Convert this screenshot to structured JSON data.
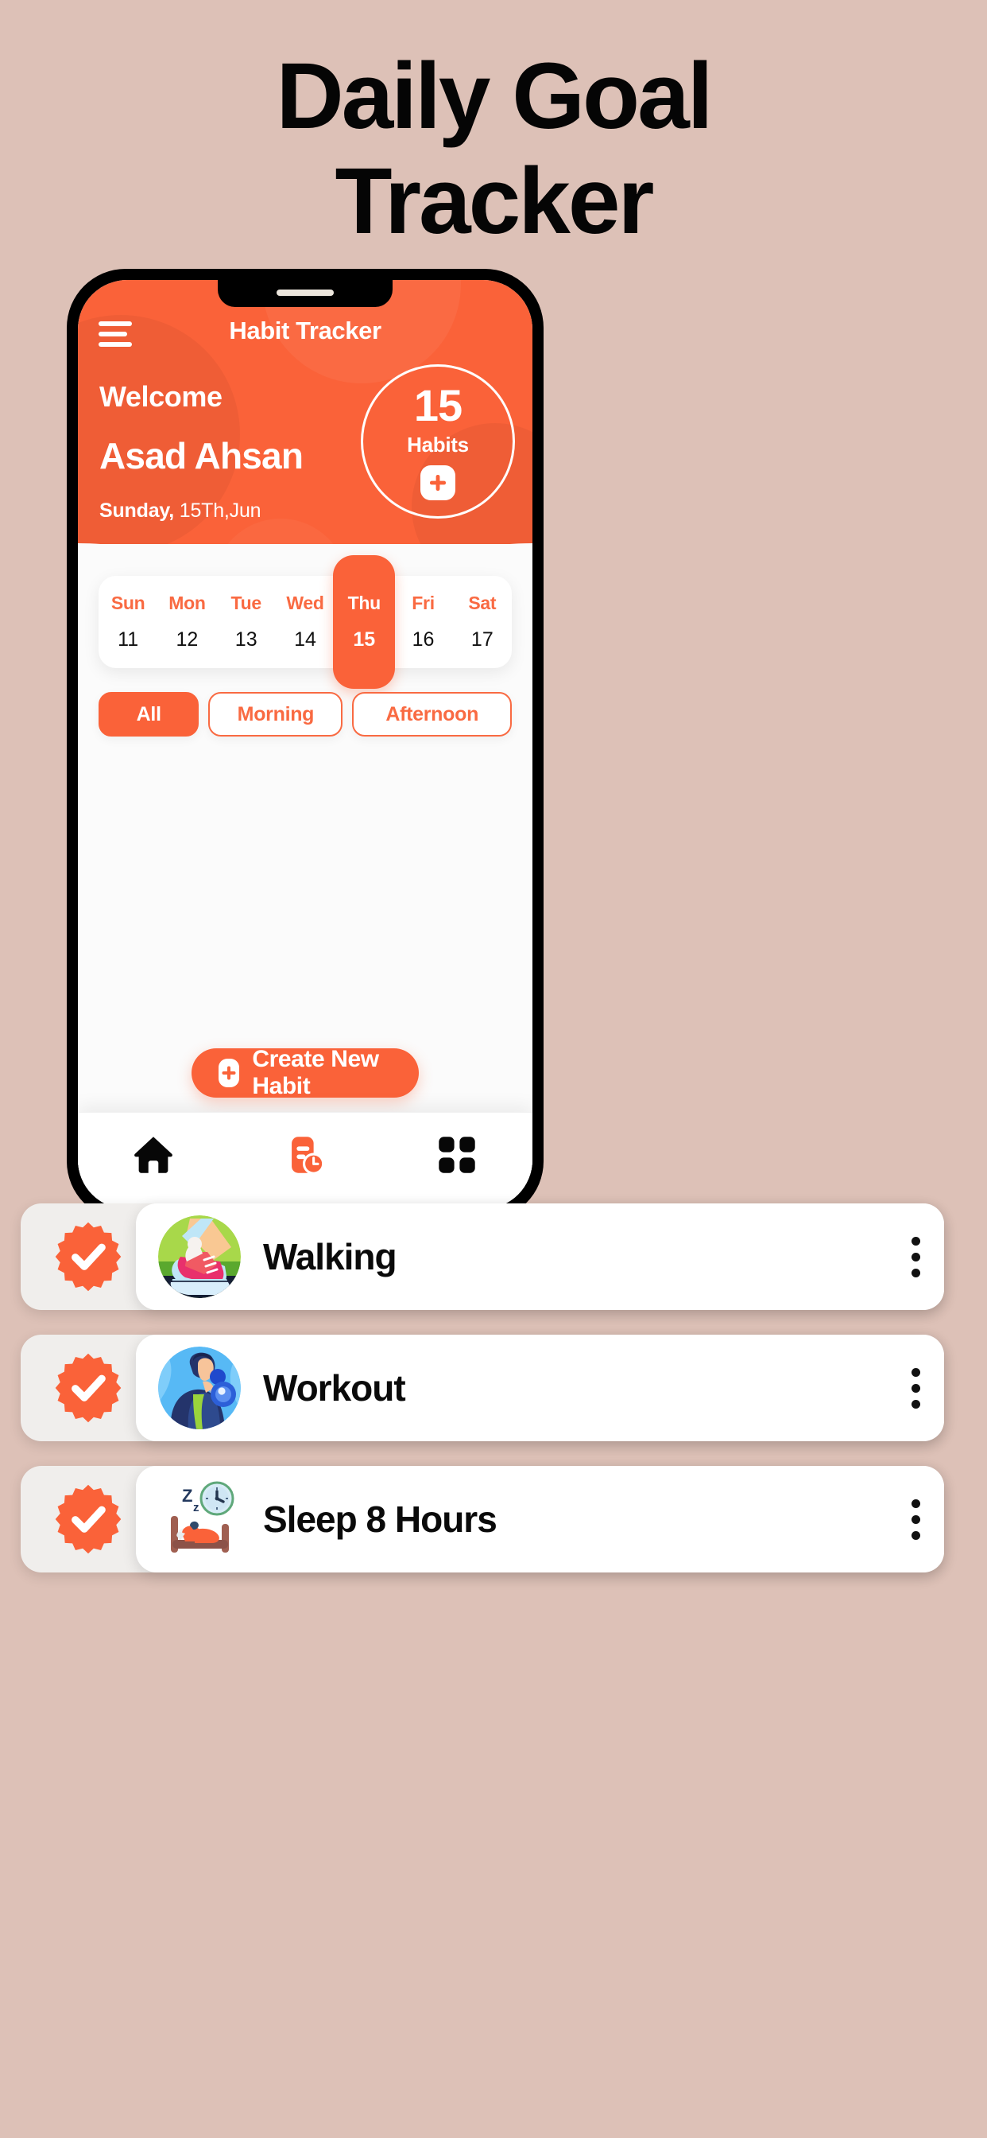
{
  "poster": {
    "title_line1": "Daily Goal",
    "title_line2": "Tracker",
    "background_color": "#ddc1b7"
  },
  "theme": {
    "accent": "#fa6239",
    "accent_text": "#f96a42",
    "text_dark": "#0a0a0a",
    "surface": "#ffffff",
    "tray": "#f0eeec"
  },
  "app": {
    "header": {
      "menu_icon": "hamburger-icon",
      "title": "Habit Tracker",
      "welcome_label": "Welcome",
      "user_name": "Asad Ahsan",
      "date_day": "Sunday,",
      "date_rest": "15Th,Jun",
      "ring": {
        "count": "15",
        "label": "Habits",
        "add_icon": "plus-icon"
      }
    },
    "week": {
      "days": [
        {
          "name": "Sun",
          "num": "11",
          "selected": false
        },
        {
          "name": "Mon",
          "num": "12",
          "selected": false
        },
        {
          "name": "Tue",
          "num": "13",
          "selected": false
        },
        {
          "name": "Wed",
          "num": "14",
          "selected": false
        },
        {
          "name": "Thu",
          "num": "15",
          "selected": true
        },
        {
          "name": "Fri",
          "num": "16",
          "selected": false
        },
        {
          "name": "Sat",
          "num": "17",
          "selected": false
        }
      ]
    },
    "filters": [
      {
        "label": "All",
        "active": true
      },
      {
        "label": "Morning",
        "active": false
      },
      {
        "label": "Afternoon",
        "active": false
      }
    ],
    "habits": [
      {
        "name": "Walking",
        "icon": "sneaker-icon",
        "completed": true,
        "menu_icon": "kebab-menu-icon"
      },
      {
        "name": "Workout",
        "icon": "dumbbell-person-icon",
        "completed": true,
        "menu_icon": "kebab-menu-icon"
      },
      {
        "name": "Sleep 8 Hours",
        "icon": "bed-sleep-icon",
        "completed": true,
        "menu_icon": "kebab-menu-icon"
      }
    ],
    "create_button": {
      "label": "Create New Habit",
      "icon": "plus-icon"
    },
    "bottom_nav": [
      {
        "icon": "home-icon",
        "active": false
      },
      {
        "icon": "task-clock-icon",
        "active": true
      },
      {
        "icon": "grid-icon",
        "active": false
      }
    ]
  }
}
